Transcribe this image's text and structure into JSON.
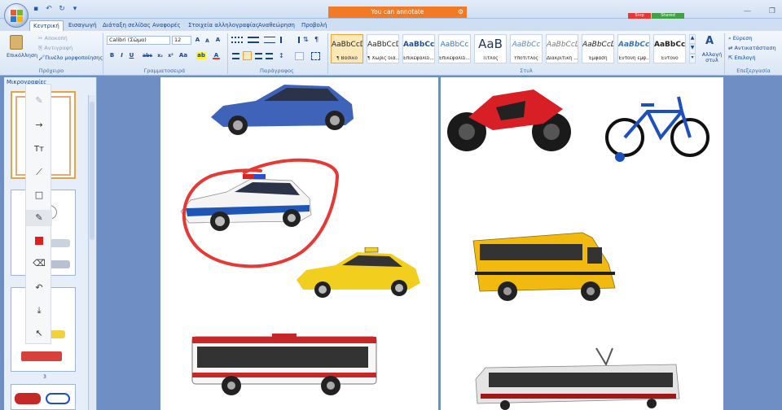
{
  "titlebar": {
    "annotate_text": "You can annotate",
    "stop_label": "Stop",
    "shared_label": "Shared",
    "minimize": "—",
    "restore": "❐"
  },
  "tabs": [
    "Κεντρική",
    "Εισαγωγή",
    "Διάταξη σελίδας",
    "Αναφορές",
    "Στοιχεία αλληλογραφίας",
    "Αναθεώρηση",
    "Προβολή"
  ],
  "ribbon": {
    "clipboard": {
      "paste": "Επικόλληση",
      "cut": "Αποκοπή",
      "copy": "Αντιγραφή",
      "format_painter": "Πινέλο μορφοποίησης",
      "label": "Πρόχειρο"
    },
    "font": {
      "name": "Calibri (Σώμα)",
      "size": "12",
      "label": "Γραμματοσειρά",
      "bold": "B",
      "italic": "I",
      "underline": "U",
      "strike": "abc",
      "sub": "x₂",
      "sup": "x²",
      "case": "Aa",
      "grow": "A",
      "shrink": "A",
      "clear": "A",
      "highlight": "ab",
      "color": "A"
    },
    "paragraph": {
      "label": "Παράγραφος"
    },
    "styles": {
      "label": "Στυλ",
      "items": [
        {
          "sample": "AaBbCcDd",
          "name": "¶ Βασικό"
        },
        {
          "sample": "AaBbCcDd",
          "name": "¶ Χωρίς διά..."
        },
        {
          "sample": "AaBbCc",
          "name": "Επικεφαλίδ..."
        },
        {
          "sample": "AaBbCc",
          "name": "Επικεφαλίδ..."
        },
        {
          "sample": "AaB",
          "name": "Τίτλος"
        },
        {
          "sample": "AaBbCc",
          "name": "Υπότιτλος"
        },
        {
          "sample": "AaBbCcDd",
          "name": "Διακριτική ..."
        },
        {
          "sample": "AaBbCcDd",
          "name": "Έμφαση"
        },
        {
          "sample": "AaBbCcDc",
          "name": "Έντονη έμφ..."
        },
        {
          "sample": "AaBbCcDc",
          "name": "Έντονο"
        }
      ],
      "change_styles": "Αλλαγή στυλ"
    },
    "editing": {
      "label": "Επεξεργασία",
      "find": "Εύρεση",
      "replace": "Αντικατάσταση",
      "select": "Επιλογή"
    }
  },
  "left_panel": {
    "title": "Μικρογραφίες",
    "page_number": "3"
  },
  "colors": {
    "accent": "#f07a25",
    "workspace": "#6e8ec4",
    "annotation": "#e53935"
  }
}
